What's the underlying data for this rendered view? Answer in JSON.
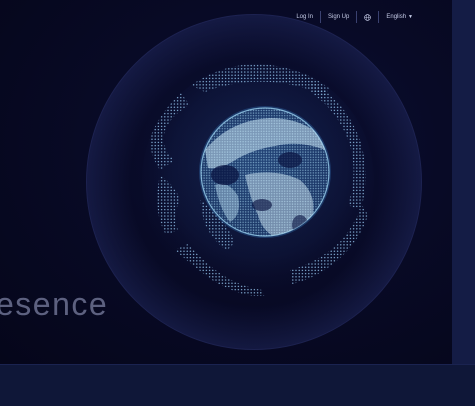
{
  "nav": {
    "login_label": "Log In",
    "signup_label": "Sign Up",
    "language_icon": "globe-icon",
    "language_label": "English",
    "language_caret_icon": "caret-down-icon"
  },
  "hero": {
    "headline_fragment": "esence"
  },
  "colors": {
    "background": "#05061a",
    "globe_dots": "#a9e4ff",
    "globe_glow": "#6cc8ff",
    "nav_text": "#c7cde8",
    "headline": "#5d6180",
    "footer": "#0f1738"
  }
}
